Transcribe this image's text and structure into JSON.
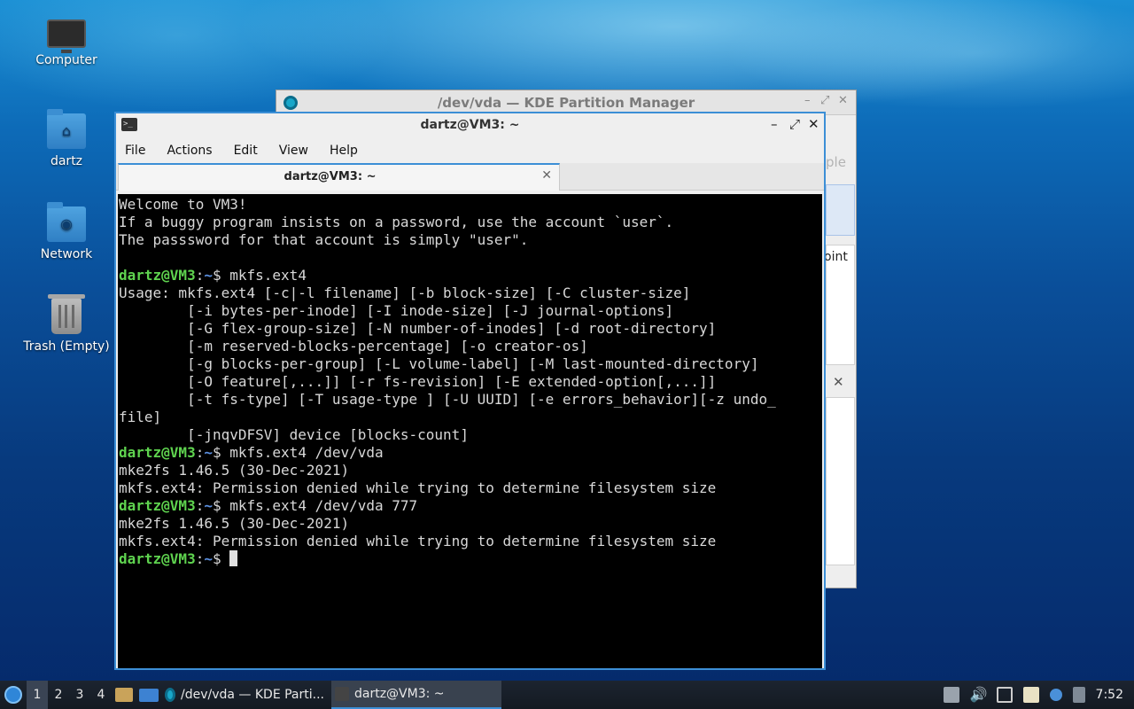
{
  "desktop": {
    "icons": [
      {
        "label": "Computer",
        "icon": "computer-icon"
      },
      {
        "label": "dartz",
        "icon": "home-folder-icon"
      },
      {
        "label": "Network",
        "icon": "network-folder-icon"
      },
      {
        "label": "Trash (Empty)",
        "icon": "trash-icon"
      }
    ]
  },
  "kde_window": {
    "title": "/dev/vda — KDE Partition Manager",
    "partial_texts": [
      "ple",
      "oint"
    ]
  },
  "terminal": {
    "title": "dartz@VM3: ~",
    "menu": [
      "File",
      "Actions",
      "Edit",
      "View",
      "Help"
    ],
    "tab_label": "dartz@VM3: ~",
    "prompt_user": "dartz@VM3",
    "prompt_path": "~",
    "lines": [
      {
        "type": "out",
        "text": "Welcome to VM3!"
      },
      {
        "type": "out",
        "text": "If a buggy program insists on a password, use the account `user`."
      },
      {
        "type": "out",
        "text": "The passsword for that account is simply \"user\"."
      },
      {
        "type": "out",
        "text": ""
      },
      {
        "type": "cmd",
        "text": "mkfs.ext4"
      },
      {
        "type": "out",
        "text": "Usage: mkfs.ext4 [-c|-l filename] [-b block-size] [-C cluster-size]"
      },
      {
        "type": "out",
        "text": "        [-i bytes-per-inode] [-I inode-size] [-J journal-options]"
      },
      {
        "type": "out",
        "text": "        [-G flex-group-size] [-N number-of-inodes] [-d root-directory]"
      },
      {
        "type": "out",
        "text": "        [-m reserved-blocks-percentage] [-o creator-os]"
      },
      {
        "type": "out",
        "text": "        [-g blocks-per-group] [-L volume-label] [-M last-mounted-directory]"
      },
      {
        "type": "out",
        "text": "        [-O feature[,...]] [-r fs-revision] [-E extended-option[,...]]"
      },
      {
        "type": "out",
        "text": "        [-t fs-type] [-T usage-type ] [-U UUID] [-e errors_behavior][-z undo_"
      },
      {
        "type": "out",
        "text": "file]"
      },
      {
        "type": "out",
        "text": "        [-jnqvDFSV] device [blocks-count]"
      },
      {
        "type": "cmd",
        "text": "mkfs.ext4 /dev/vda"
      },
      {
        "type": "out",
        "text": "mke2fs 1.46.5 (30-Dec-2021)"
      },
      {
        "type": "out",
        "text": "mkfs.ext4: Permission denied while trying to determine filesystem size"
      },
      {
        "type": "cmd",
        "text": "mkfs.ext4 /dev/vda 777"
      },
      {
        "type": "out",
        "text": "mke2fs 1.46.5 (30-Dec-2021)"
      },
      {
        "type": "out",
        "text": "mkfs.ext4: Permission denied while trying to determine filesystem size"
      },
      {
        "type": "prompt",
        "text": ""
      }
    ]
  },
  "taskbar": {
    "workspaces": [
      "1",
      "2",
      "3",
      "4"
    ],
    "active_workspace": "1",
    "tasks": [
      {
        "label": "/dev/vda — KDE Parti...",
        "icon": "partition-manager-icon"
      },
      {
        "label": "dartz@VM3: ~",
        "icon": "terminal-icon"
      }
    ],
    "clock": "7:52"
  }
}
